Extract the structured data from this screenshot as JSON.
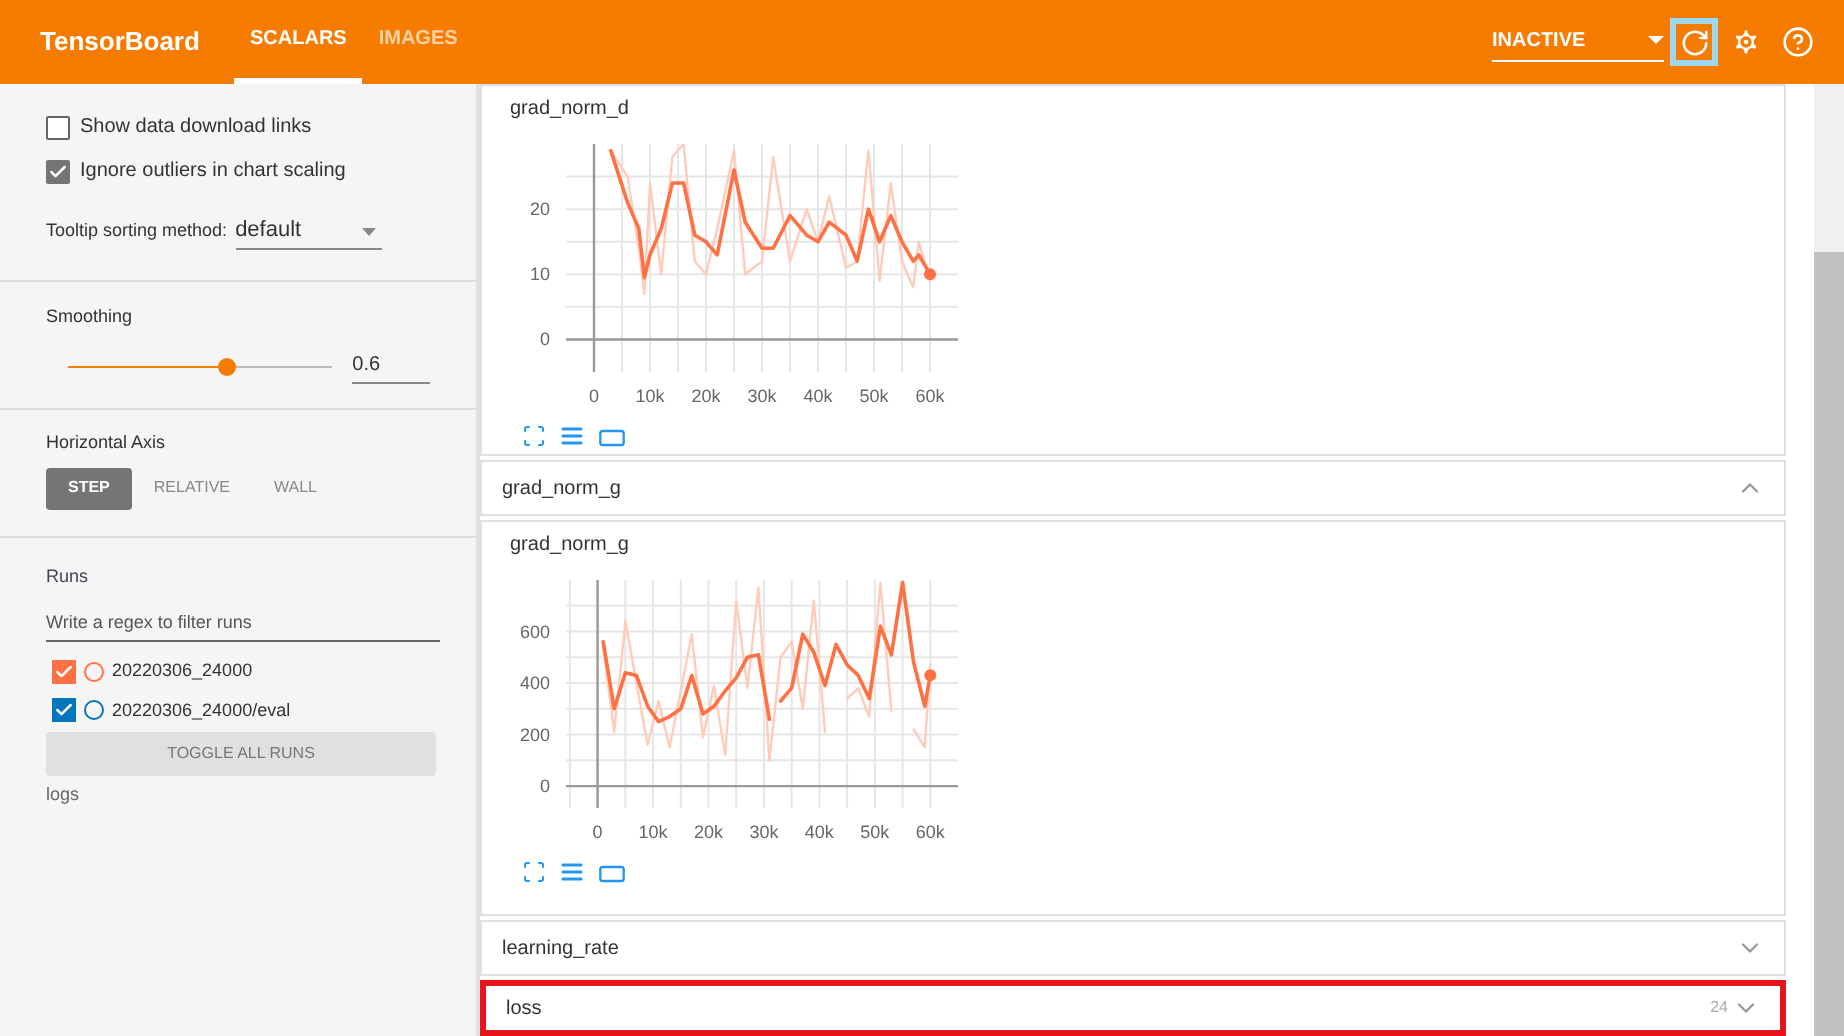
{
  "header": {
    "title": "TensorBoard",
    "tabs": [
      {
        "label": "SCALARS",
        "selected": true
      },
      {
        "label": "IMAGES",
        "selected": false
      }
    ],
    "status": {
      "value": "INACTIVE"
    },
    "buttons": [
      {
        "kind": "refresh",
        "highlighted": true
      },
      {
        "kind": "settings",
        "highlighted": false
      },
      {
        "kind": "help",
        "highlighted": false
      }
    ]
  },
  "sidebar": {
    "checkboxes": [
      {
        "label": "Show data download links",
        "checked": false
      },
      {
        "label": "Ignore outliers in chart scaling",
        "checked": true
      }
    ],
    "tooltip_sort": {
      "label": "Tooltip sorting method:",
      "value": "default"
    },
    "smoothing": {
      "label": "Smoothing",
      "level": 0.6,
      "value": "0.6"
    },
    "horizontal_axis": {
      "label": "Horizontal Axis",
      "options": [
        {
          "label": "STEP",
          "selected": true
        },
        {
          "label": "RELATIVE",
          "selected": false
        },
        {
          "label": "WALL",
          "selected": false
        }
      ]
    },
    "runs": {
      "label": "Runs",
      "placeholder": "Write a regex to filter runs",
      "items": [
        {
          "name": "20220306_24000",
          "checked": true,
          "color": "#ff7043"
        },
        {
          "name": "20220306_24000/eval",
          "checked": true,
          "color": "#0277bd"
        }
      ],
      "toggle_button": "TOGGLE ALL RUNS",
      "footer": "logs"
    }
  },
  "main": {
    "items": [
      {
        "kind": "chart",
        "chart_data": {
          "type": "line",
          "grid": true,
          "title": "grad_norm_d",
          "xlim": [
            -5000,
            65000
          ],
          "ylim": [
            -5,
            30
          ],
          "xticks": [
            {
              "value": 0,
              "label": "0"
            },
            {
              "value": 10000,
              "label": "10k"
            },
            {
              "value": 20000,
              "label": "20k"
            },
            {
              "value": 30000,
              "label": "30k"
            },
            {
              "value": 40000,
              "label": "40k"
            },
            {
              "value": 50000,
              "label": "50k"
            },
            {
              "value": 60000,
              "label": "60k"
            }
          ],
          "yticks": [
            0,
            10,
            20
          ],
          "x": [
            3000,
            6000,
            8000,
            9000,
            10000,
            12000,
            14000,
            16000,
            18000,
            20000,
            22000,
            25000,
            27000,
            30000,
            32000,
            35000,
            38000,
            40000,
            42000,
            45000,
            47000,
            49000,
            51000,
            53000,
            55000,
            57000,
            58000,
            60000
          ],
          "series": [
            {
              "color": "#ffccbc",
              "values": [
                29,
                25,
                14,
                7,
                24,
                10,
                28,
                30,
                12,
                10,
                17,
                29,
                10,
                12,
                28,
                12,
                20,
                15,
                22,
                11,
                12,
                29,
                9,
                24,
                12,
                8,
                15,
                9
              ]
            },
            {
              "color": "#ff7043",
              "values": [
                29,
                21,
                17,
                9.5,
                13,
                17,
                24,
                24,
                16,
                15,
                13,
                26,
                18,
                14,
                14,
                19,
                16,
                15,
                18,
                16,
                12,
                20,
                15,
                19,
                15,
                12,
                13,
                10
              ]
            }
          ]
        }
      },
      {
        "kind": "group",
        "title": "grad_norm_g",
        "expanded": true
      },
      {
        "kind": "chart",
        "chart_data": {
          "type": "line",
          "grid": true,
          "title": "grad_norm_g",
          "xlim": [
            -5700,
            65000
          ],
          "ylim": [
            -85,
            800
          ],
          "xticks": [
            {
              "value": 0,
              "label": "0"
            },
            {
              "value": 10000,
              "label": "10k"
            },
            {
              "value": 20000,
              "label": "20k"
            },
            {
              "value": 30000,
              "label": "30k"
            },
            {
              "value": 40000,
              "label": "40k"
            },
            {
              "value": 50000,
              "label": "50k"
            },
            {
              "value": 60000,
              "label": "60k"
            }
          ],
          "yticks": [
            0,
            200,
            400,
            600
          ],
          "x": [
            1000,
            3000,
            5000,
            7000,
            9000,
            11000,
            13000,
            15000,
            17000,
            19000,
            21000,
            23000,
            25000,
            27000,
            29000,
            31000,
            32000,
            33000,
            35000,
            37000,
            39000,
            41000,
            43000,
            45000,
            47000,
            49000,
            51000,
            53000,
            55000,
            57000,
            59000,
            60000
          ],
          "series": [
            {
              "color": "#ffccbc",
              "values": [
                540,
                210,
                640,
                400,
                160,
                330,
                150,
                370,
                590,
                190,
                390,
                120,
                720,
                380,
                770,
                100,
                300,
                500,
                560,
                300,
                720,
                210,
                null,
                340,
                380,
                270,
                790,
                290,
                null,
                220,
                150,
                470
              ]
            },
            {
              "color": "#ff7043",
              "values": [
                560,
                300,
                440,
                430,
                310,
                250,
                270,
                300,
                430,
                280,
                310,
                370,
                420,
                500,
                510,
                260,
                null,
                330,
                380,
                590,
                520,
                390,
                550,
                470,
                430,
                340,
                620,
                510,
                790,
                480,
                310,
                430
              ]
            }
          ]
        }
      },
      {
        "kind": "group",
        "title": "learning_rate",
        "expanded": false
      },
      {
        "kind": "group",
        "title": "loss",
        "expanded": false,
        "count": "24",
        "highlighted": true
      }
    ]
  }
}
